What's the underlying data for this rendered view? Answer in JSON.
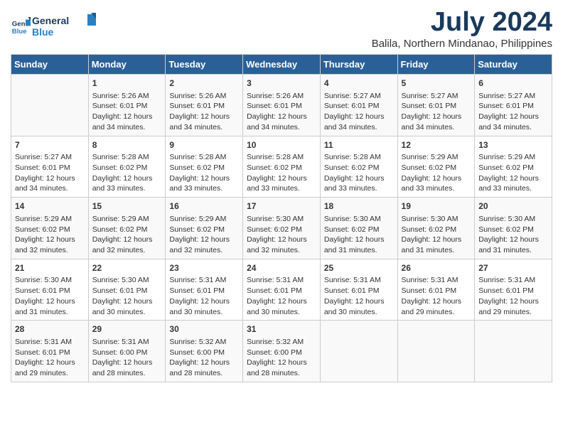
{
  "logo": {
    "line1": "General",
    "line2": "Blue"
  },
  "title": "July 2024",
  "subtitle": "Balila, Northern Mindanao, Philippines",
  "header_days": [
    "Sunday",
    "Monday",
    "Tuesday",
    "Wednesday",
    "Thursday",
    "Friday",
    "Saturday"
  ],
  "weeks": [
    [
      {
        "day": "",
        "info": ""
      },
      {
        "day": "1",
        "info": "Sunrise: 5:26 AM\nSunset: 6:01 PM\nDaylight: 12 hours\nand 34 minutes."
      },
      {
        "day": "2",
        "info": "Sunrise: 5:26 AM\nSunset: 6:01 PM\nDaylight: 12 hours\nand 34 minutes."
      },
      {
        "day": "3",
        "info": "Sunrise: 5:26 AM\nSunset: 6:01 PM\nDaylight: 12 hours\nand 34 minutes."
      },
      {
        "day": "4",
        "info": "Sunrise: 5:27 AM\nSunset: 6:01 PM\nDaylight: 12 hours\nand 34 minutes."
      },
      {
        "day": "5",
        "info": "Sunrise: 5:27 AM\nSunset: 6:01 PM\nDaylight: 12 hours\nand 34 minutes."
      },
      {
        "day": "6",
        "info": "Sunrise: 5:27 AM\nSunset: 6:01 PM\nDaylight: 12 hours\nand 34 minutes."
      }
    ],
    [
      {
        "day": "7",
        "info": "Sunrise: 5:27 AM\nSunset: 6:01 PM\nDaylight: 12 hours\nand 34 minutes."
      },
      {
        "day": "8",
        "info": "Sunrise: 5:28 AM\nSunset: 6:02 PM\nDaylight: 12 hours\nand 33 minutes."
      },
      {
        "day": "9",
        "info": "Sunrise: 5:28 AM\nSunset: 6:02 PM\nDaylight: 12 hours\nand 33 minutes."
      },
      {
        "day": "10",
        "info": "Sunrise: 5:28 AM\nSunset: 6:02 PM\nDaylight: 12 hours\nand 33 minutes."
      },
      {
        "day": "11",
        "info": "Sunrise: 5:28 AM\nSunset: 6:02 PM\nDaylight: 12 hours\nand 33 minutes."
      },
      {
        "day": "12",
        "info": "Sunrise: 5:29 AM\nSunset: 6:02 PM\nDaylight: 12 hours\nand 33 minutes."
      },
      {
        "day": "13",
        "info": "Sunrise: 5:29 AM\nSunset: 6:02 PM\nDaylight: 12 hours\nand 33 minutes."
      }
    ],
    [
      {
        "day": "14",
        "info": "Sunrise: 5:29 AM\nSunset: 6:02 PM\nDaylight: 12 hours\nand 32 minutes."
      },
      {
        "day": "15",
        "info": "Sunrise: 5:29 AM\nSunset: 6:02 PM\nDaylight: 12 hours\nand 32 minutes."
      },
      {
        "day": "16",
        "info": "Sunrise: 5:29 AM\nSunset: 6:02 PM\nDaylight: 12 hours\nand 32 minutes."
      },
      {
        "day": "17",
        "info": "Sunrise: 5:30 AM\nSunset: 6:02 PM\nDaylight: 12 hours\nand 32 minutes."
      },
      {
        "day": "18",
        "info": "Sunrise: 5:30 AM\nSunset: 6:02 PM\nDaylight: 12 hours\nand 31 minutes."
      },
      {
        "day": "19",
        "info": "Sunrise: 5:30 AM\nSunset: 6:02 PM\nDaylight: 12 hours\nand 31 minutes."
      },
      {
        "day": "20",
        "info": "Sunrise: 5:30 AM\nSunset: 6:02 PM\nDaylight: 12 hours\nand 31 minutes."
      }
    ],
    [
      {
        "day": "21",
        "info": "Sunrise: 5:30 AM\nSunset: 6:01 PM\nDaylight: 12 hours\nand 31 minutes."
      },
      {
        "day": "22",
        "info": "Sunrise: 5:30 AM\nSunset: 6:01 PM\nDaylight: 12 hours\nand 30 minutes."
      },
      {
        "day": "23",
        "info": "Sunrise: 5:31 AM\nSunset: 6:01 PM\nDaylight: 12 hours\nand 30 minutes."
      },
      {
        "day": "24",
        "info": "Sunrise: 5:31 AM\nSunset: 6:01 PM\nDaylight: 12 hours\nand 30 minutes."
      },
      {
        "day": "25",
        "info": "Sunrise: 5:31 AM\nSunset: 6:01 PM\nDaylight: 12 hours\nand 30 minutes."
      },
      {
        "day": "26",
        "info": "Sunrise: 5:31 AM\nSunset: 6:01 PM\nDaylight: 12 hours\nand 29 minutes."
      },
      {
        "day": "27",
        "info": "Sunrise: 5:31 AM\nSunset: 6:01 PM\nDaylight: 12 hours\nand 29 minutes."
      }
    ],
    [
      {
        "day": "28",
        "info": "Sunrise: 5:31 AM\nSunset: 6:01 PM\nDaylight: 12 hours\nand 29 minutes."
      },
      {
        "day": "29",
        "info": "Sunrise: 5:31 AM\nSunset: 6:00 PM\nDaylight: 12 hours\nand 28 minutes."
      },
      {
        "day": "30",
        "info": "Sunrise: 5:32 AM\nSunset: 6:00 PM\nDaylight: 12 hours\nand 28 minutes."
      },
      {
        "day": "31",
        "info": "Sunrise: 5:32 AM\nSunset: 6:00 PM\nDaylight: 12 hours\nand 28 minutes."
      },
      {
        "day": "",
        "info": ""
      },
      {
        "day": "",
        "info": ""
      },
      {
        "day": "",
        "info": ""
      }
    ]
  ]
}
